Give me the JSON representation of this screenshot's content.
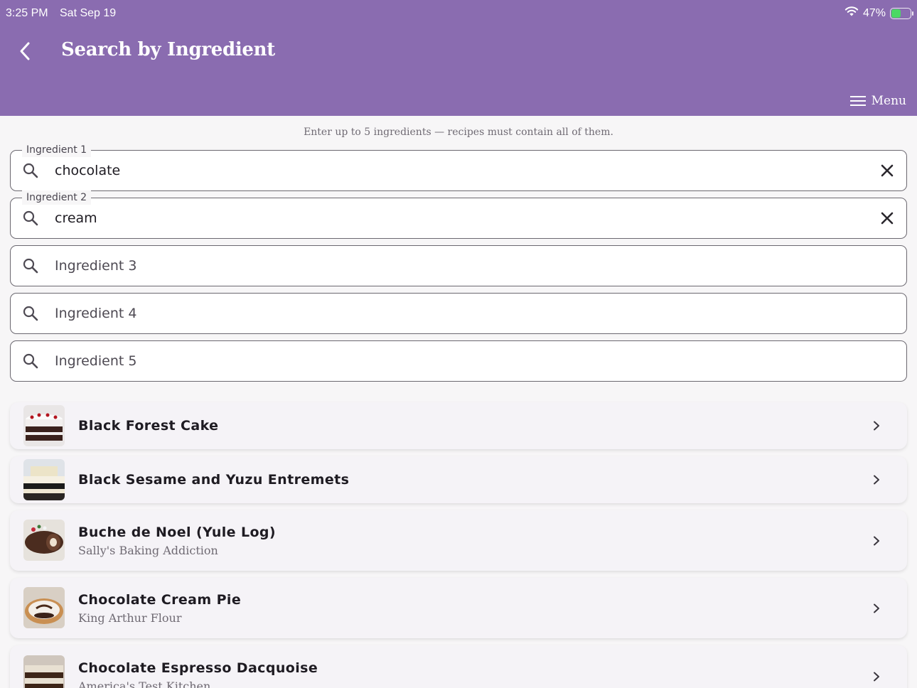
{
  "status": {
    "time": "3:25 PM",
    "date": "Sat Sep 19",
    "battery": "47%",
    "battery_level": 0.47
  },
  "header": {
    "title": "Search by Ingredient",
    "menu_label": "Menu"
  },
  "hint": "Enter up to 5 ingredients — recipes must contain all of them.",
  "ingredients": [
    {
      "label": "Ingredient 1",
      "value": "chocolate",
      "placeholder": ""
    },
    {
      "label": "Ingredient 2",
      "value": "cream",
      "placeholder": ""
    },
    {
      "label": "",
      "value": "",
      "placeholder": "Ingredient 3"
    },
    {
      "label": "",
      "value": "",
      "placeholder": "Ingredient 4"
    },
    {
      "label": "",
      "value": "",
      "placeholder": "Ingredient 5"
    }
  ],
  "results": [
    {
      "title": "Black Forest Cake",
      "source": ""
    },
    {
      "title": "Black Sesame and Yuzu Entremets",
      "source": ""
    },
    {
      "title": "Buche de Noel (Yule Log)",
      "source": "Sally's Baking Addiction"
    },
    {
      "title": "Chocolate Cream Pie",
      "source": "King Arthur Flour"
    },
    {
      "title": "Chocolate Espresso Dacquoise",
      "source": "America's Test Kitchen"
    }
  ],
  "colors": {
    "header": "#8a6cb0",
    "background": "#f7f6f7",
    "card": "#f5f3f7",
    "battery_fill": "#4cd964"
  }
}
